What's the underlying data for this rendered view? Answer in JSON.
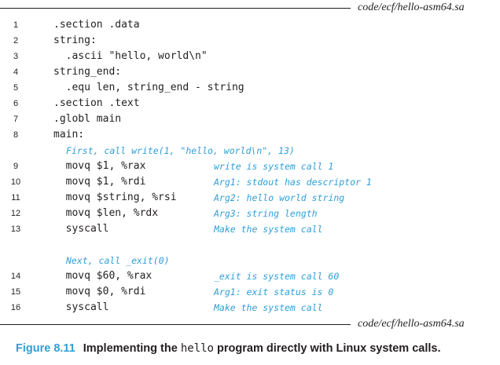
{
  "header": {
    "file_label": "code/ecf/hello-asm64.sa"
  },
  "code_lines": [
    {
      "num": "1",
      "code": ".section .data",
      "comment": ""
    },
    {
      "num": "2",
      "code": "string:",
      "comment": ""
    },
    {
      "num": "3",
      "code": "  .ascii \"hello, world\\n\"",
      "comment": ""
    },
    {
      "num": "4",
      "code": "string_end:",
      "comment": ""
    },
    {
      "num": "5",
      "code": "  .equ len, string_end - string",
      "comment": ""
    },
    {
      "num": "6",
      "code": ".section .text",
      "comment": ""
    },
    {
      "num": "7",
      "code": ".globl main",
      "comment": ""
    },
    {
      "num": "8",
      "code": "main:",
      "comment": ""
    },
    {
      "num": "",
      "code": "",
      "comment": "First, call write(1, \"hello, world\\n\", 13)"
    },
    {
      "num": "9",
      "code": "  movq $1, %rax",
      "comment": "write is system call 1"
    },
    {
      "num": "10",
      "code": "  movq $1, %rdi",
      "comment": "Arg1: stdout has descriptor 1"
    },
    {
      "num": "11",
      "code": "  movq $string, %rsi",
      "comment": "Arg2: hello world string"
    },
    {
      "num": "12",
      "code": "  movq $len, %rdx",
      "comment": "Arg3: string length"
    },
    {
      "num": "13",
      "code": "  syscall",
      "comment": "Make the system call"
    },
    {
      "num": "",
      "code": "",
      "comment": ""
    },
    {
      "num": "",
      "code": "",
      "comment": "Next, call _exit(0)"
    },
    {
      "num": "14",
      "code": "  movq $60, %rax",
      "comment": "_exit is system call 60"
    },
    {
      "num": "15",
      "code": "  movq $0, %rdi",
      "comment": "Arg1: exit status is 0"
    },
    {
      "num": "16",
      "code": "  syscall",
      "comment": "Make the system call"
    }
  ],
  "footer": {
    "file_label": "code/ecf/hello-asm64.sa"
  },
  "caption": {
    "figure_number": "Figure 8.11",
    "text_before": "Implementing the ",
    "text_mono": "hello",
    "text_after": " program directly with Linux system calls."
  },
  "colors": {
    "accent": "#2f9fd8",
    "text": "#231f20"
  }
}
